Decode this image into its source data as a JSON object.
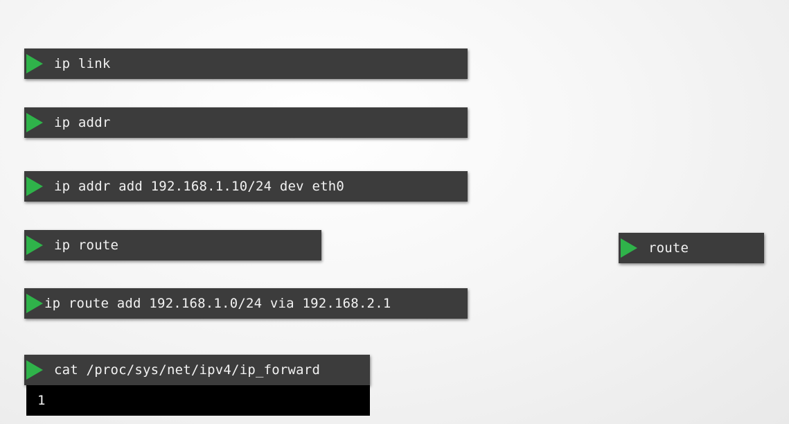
{
  "commands": [
    {
      "id": "ip-link",
      "text": "ip link"
    },
    {
      "id": "ip-addr",
      "text": "ip addr"
    },
    {
      "id": "ip-addr-add",
      "text": "ip addr add 192.168.1.10/24 dev eth0"
    },
    {
      "id": "ip-route",
      "text": "ip route"
    },
    {
      "id": "route",
      "text": "route"
    },
    {
      "id": "ip-route-add",
      "text": "ip route add 192.168.1.0/24 via 192.168.2.1"
    },
    {
      "id": "cat-ip-forward",
      "text": "cat /proc/sys/net/ipv4/ip_forward",
      "output": "1"
    }
  ],
  "icons": {
    "command_marker": "play-icon"
  },
  "colors": {
    "command_background": "#3c3c3c",
    "command_text": "#f2f2f2",
    "marker": "#2fb34a",
    "output_background": "#000000"
  }
}
